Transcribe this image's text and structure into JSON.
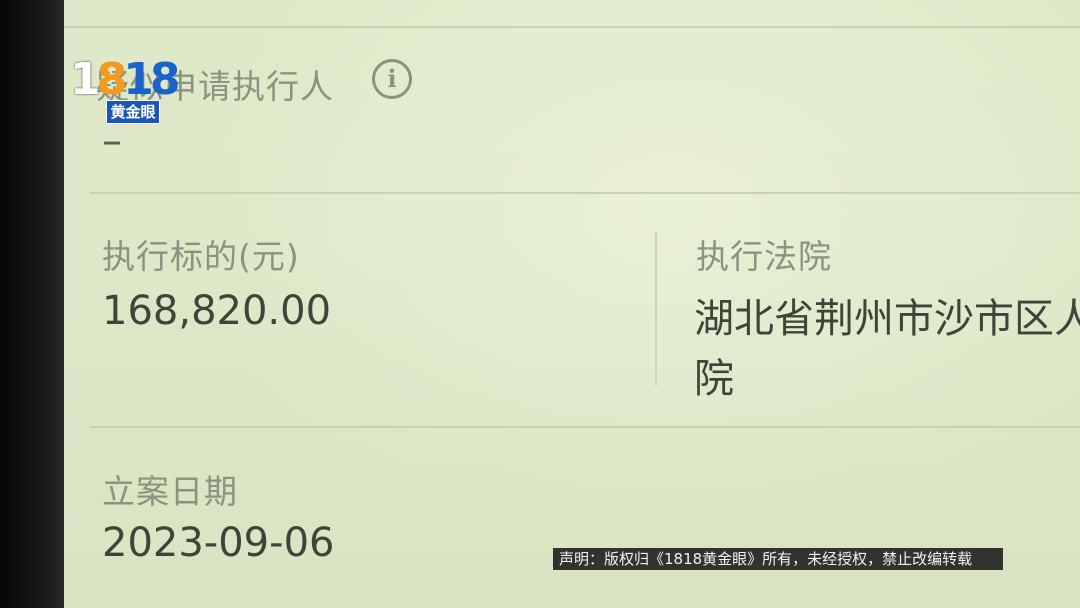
{
  "record": {
    "applicant_label": "疑似申请执行人",
    "applicant_value": "–",
    "amount_label": "执行标的(元)",
    "amount_value": "168,820.00",
    "court_label": "执行法院",
    "court_value_line1": "湖北省荆州市沙市区人",
    "court_value_line2": "院",
    "date_label": "立案日期",
    "date_value": "2023-09-06"
  },
  "icons": {
    "applicant_info": "info-icon"
  },
  "overlay": {
    "logo_digits_a": "1",
    "logo_digits_b": "8",
    "logo_digits_c": "18",
    "logo_name": "黄金眼",
    "disclaimer": "声明：版权归《1818黄金眼》所有，未经授权，禁止改编转载"
  },
  "colors": {
    "screen_bg": "#dde8c8",
    "label": "#8b927f",
    "value": "#3f443a",
    "logo_orange": "#f39a1e",
    "logo_blue": "#1b63c9"
  }
}
